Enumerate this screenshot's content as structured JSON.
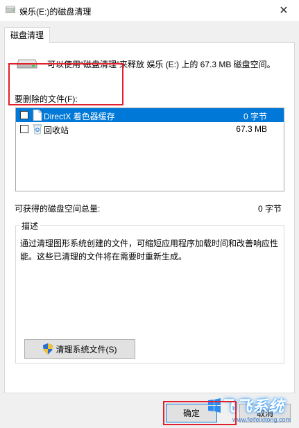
{
  "window": {
    "title": "娱乐(E:)的磁盘清理",
    "close_glyph": "✕"
  },
  "tabs": [
    {
      "label": "磁盘清理"
    }
  ],
  "summary": {
    "text": "可以使用“磁盘清理”来释放 娱乐 (E:) 上的 67.3 MB 磁盘空间。"
  },
  "files": {
    "label": "要删除的文件(F):",
    "items": [
      {
        "name": "DirectX 着色器缓存",
        "size": "0 字节",
        "checked": false,
        "selected": true,
        "icon": "file-icon"
      },
      {
        "name": "回收站",
        "size": "67.3 MB",
        "checked": false,
        "selected": false,
        "icon": "recycle-bin-icon"
      }
    ]
  },
  "total": {
    "label": "可获得的磁盘空间总量:",
    "value": "0 字节"
  },
  "description": {
    "title": "描述",
    "text": "通过清理图形系统创建的文件，可缩短应用程序加载时间和改善响应性能。这些已清理的文件将在需要时重新生成。"
  },
  "buttons": {
    "clean_system": "清理系统文件(S)",
    "ok": "确定",
    "cancel": "取消"
  },
  "watermark": {
    "text": "飞飞系统",
    "url": "www.feifeixitong.com"
  },
  "colors": {
    "selection": "#0078d7",
    "highlight": "#e0202a"
  }
}
